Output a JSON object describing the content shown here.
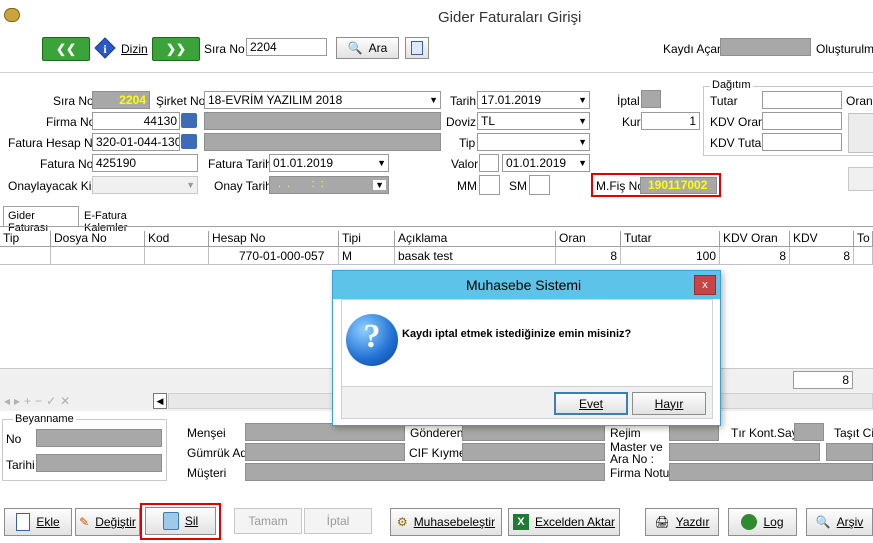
{
  "window": {
    "title": "Gider Faturaları Girişi"
  },
  "toolbar": {
    "first": "◄◄",
    "prev_icon": "info",
    "dizin": "Dizin",
    "next": "►►",
    "sira_no_label": "Sıra No",
    "sira_no_value": "2204",
    "ara": "Ara",
    "kaydi_acan": "Kaydı Açan",
    "olusturulma": "Oluşturulma"
  },
  "form": {
    "sira_no_label": "Sıra No",
    "sira_no_value": "2204",
    "sirket_no_label": "Şirket No",
    "sirket_no_value": "18-EVRİM YAZILIM 2018",
    "tarih_label": "Tarih",
    "tarih_value": "17.01.2019",
    "iptal_label": "İptal",
    "firma_no_label": "Firma No",
    "firma_no_value": "44130",
    "doviz_label": "Doviz",
    "doviz_value": "TL",
    "kur_label": "Kur",
    "kur_value": "1",
    "fatura_hesap_no_label": "Fatura Hesap No",
    "fatura_hesap_no_value": "320-01-044-130",
    "tip_label": "Tip",
    "fatura_no_label": "Fatura No",
    "fatura_no_value": "425190",
    "fatura_tarihi_label": "Fatura Tarihi",
    "fatura_tarihi_value": "01.01.2019",
    "valor_label": "Valor",
    "valor_value": "01.01.2019",
    "onaylayacak_label": "Onaylayacak Kişi",
    "onay_tarihi_label": "Onay Tarihi",
    "onay_tarihi_value": ".  .       :  :",
    "mm_label": "MM",
    "sm_label": "SM",
    "mfis_label": "M.Fiş No",
    "mfis_value": "190117002"
  },
  "dagitim": {
    "title": "Dağıtım",
    "tutar": "Tutar",
    "kdv_oran": "KDV Oran",
    "kdv_tutar": "KDV Tutar",
    "oran": "Oran"
  },
  "tabs": [
    "Gider Faturası",
    "E-Fatura Kalemler"
  ],
  "table": {
    "headers": [
      "Tip",
      "Dosya No",
      "Kod",
      "Hesap No",
      "Tipi",
      "Açıklama",
      "Oran",
      "Tutar",
      "KDV Oran",
      "KDV",
      "To"
    ],
    "rows": [
      [
        "",
        "",
        "",
        "770-01-000-057",
        "M",
        "basak test",
        "8",
        "100",
        "8",
        "8",
        ""
      ]
    ],
    "footer_value": "8"
  },
  "beyanname": {
    "title": "Beyanname",
    "no": "No",
    "tarihi": "Tarihi"
  },
  "customs": {
    "mensei": "Menşei",
    "gumruk_adi": "Gümrük Adı",
    "musteri": "Müşteri",
    "gonderen": "Gönderen",
    "cif_kiymet": "CIF Kıymet",
    "rejim": "Rejim",
    "master_ve": "Master ve",
    "ara_no": "Ara No :",
    "firma_notu": "Firma Notu",
    "tir_kont_say": "Tır Kont.Say",
    "tasit_cin": "Taşıt Cin"
  },
  "bottom_buttons": {
    "ekle": "Ekle",
    "degistir": "Değiştir",
    "sil": "Sil",
    "tamam": "Tamam",
    "iptal": "İptal",
    "muhasebelestir": "Muhasebeleştir",
    "excelden_aktar": "Excelden Aktar",
    "yazdir": "Yazdır",
    "log": "Log",
    "arsiv": "Arşiv"
  },
  "dialog": {
    "title": "Muhasebe Sistemi",
    "close": "x",
    "message": "Kaydı iptal etmek istediğinize emin misiniz?",
    "icon_glyph": "?",
    "evet": "Evet",
    "hayir": "Hayır"
  },
  "colors": {
    "highlight_yellow": "#ffff00",
    "red_outline": "#e00000",
    "dialog_titlebar": "#5ec3e8",
    "grid_gray": "#a8a8a8"
  }
}
